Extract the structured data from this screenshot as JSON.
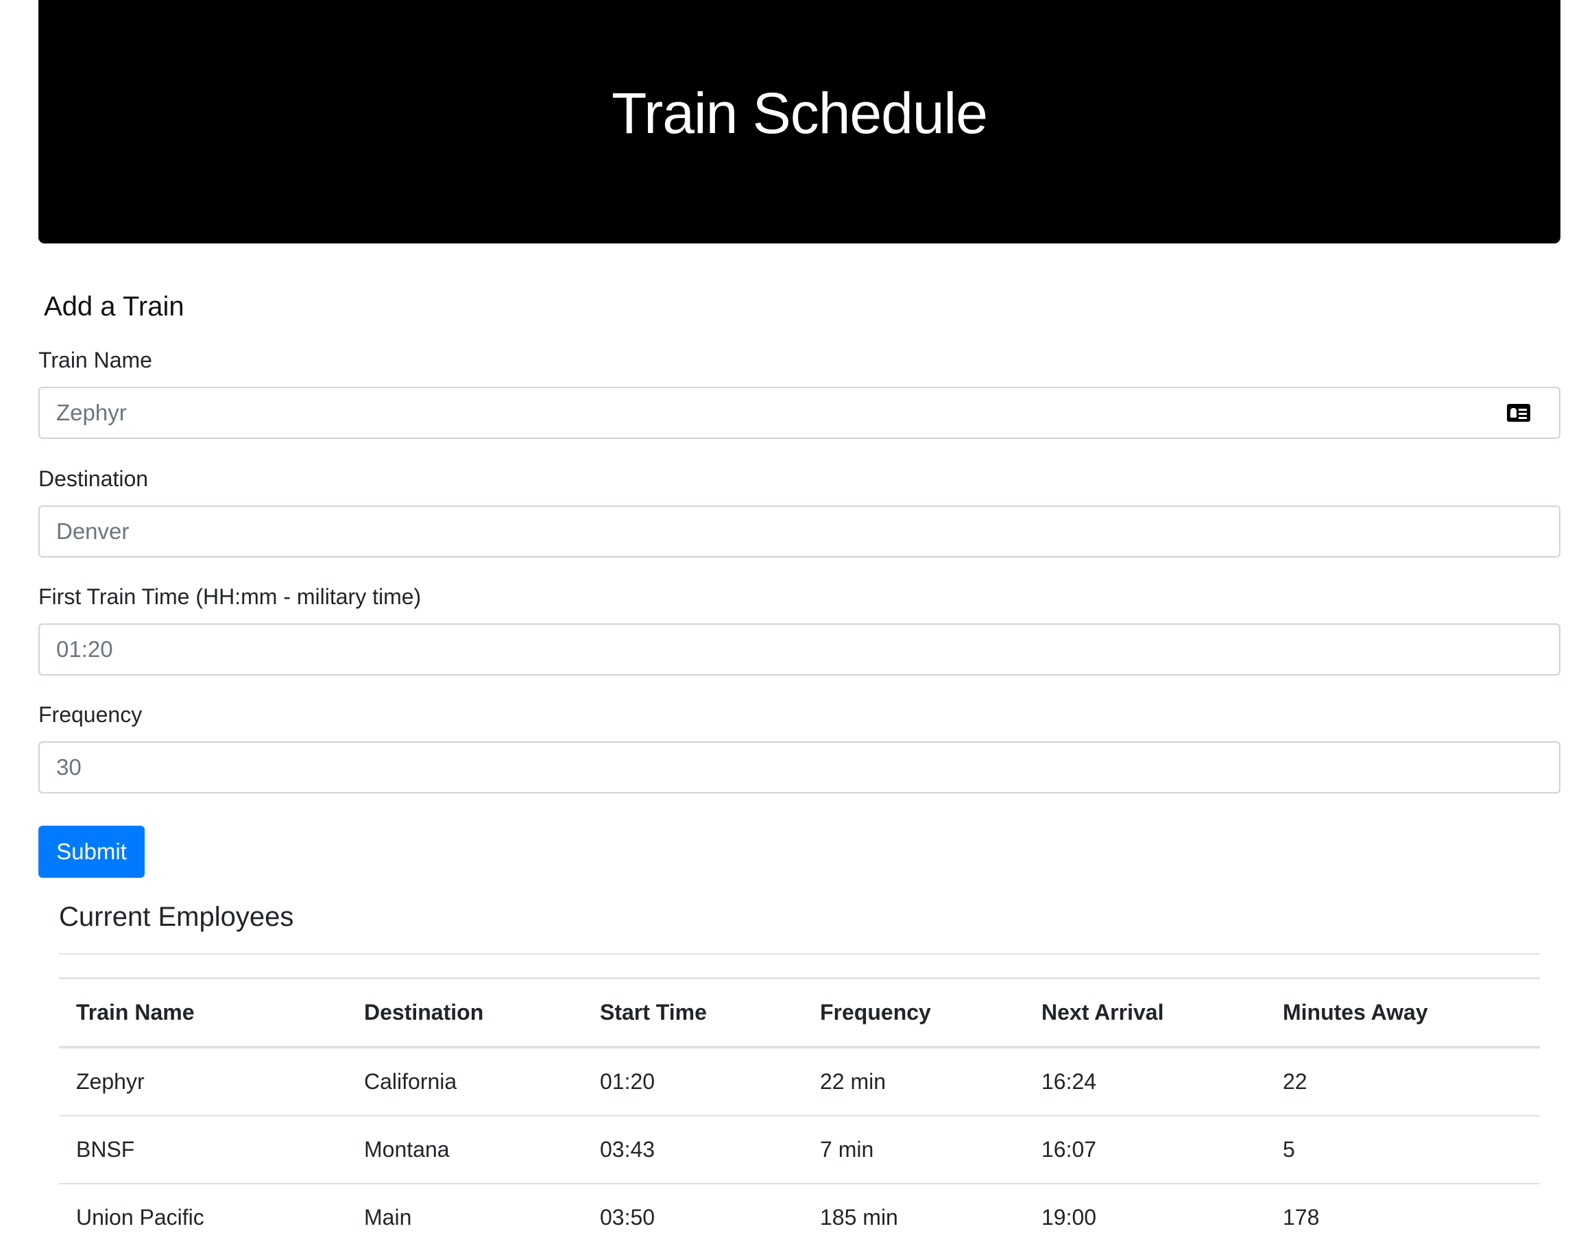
{
  "header": {
    "title": "Train Schedule"
  },
  "form": {
    "section_title": "Add a Train",
    "train_name": {
      "label": "Train Name",
      "placeholder": "Zephyr"
    },
    "destination": {
      "label": "Destination",
      "placeholder": "Denver"
    },
    "first_train_time": {
      "label": "First Train Time (HH:mm - military time)",
      "placeholder": "01:20"
    },
    "frequency": {
      "label": "Frequency",
      "placeholder": "30"
    },
    "submit_label": "Submit"
  },
  "employees": {
    "title": "Current Employees",
    "columns": [
      "Train Name",
      "Destination",
      "Start Time",
      "Frequency",
      "Next Arrival",
      "Minutes Away"
    ],
    "rows": [
      [
        "Zephyr",
        "California",
        "01:20",
        "22 min",
        "16:24",
        "22"
      ],
      [
        "BNSF",
        "Montana",
        "03:43",
        "7 min",
        "16:07",
        "5"
      ],
      [
        "Union Pacific",
        "Main",
        "03:50",
        "185 min",
        "19:00",
        "178"
      ]
    ]
  },
  "colors": {
    "header_background": "#000000",
    "accent": "#007bff"
  },
  "icons": {
    "train_name_field": "contact-card-icon"
  }
}
